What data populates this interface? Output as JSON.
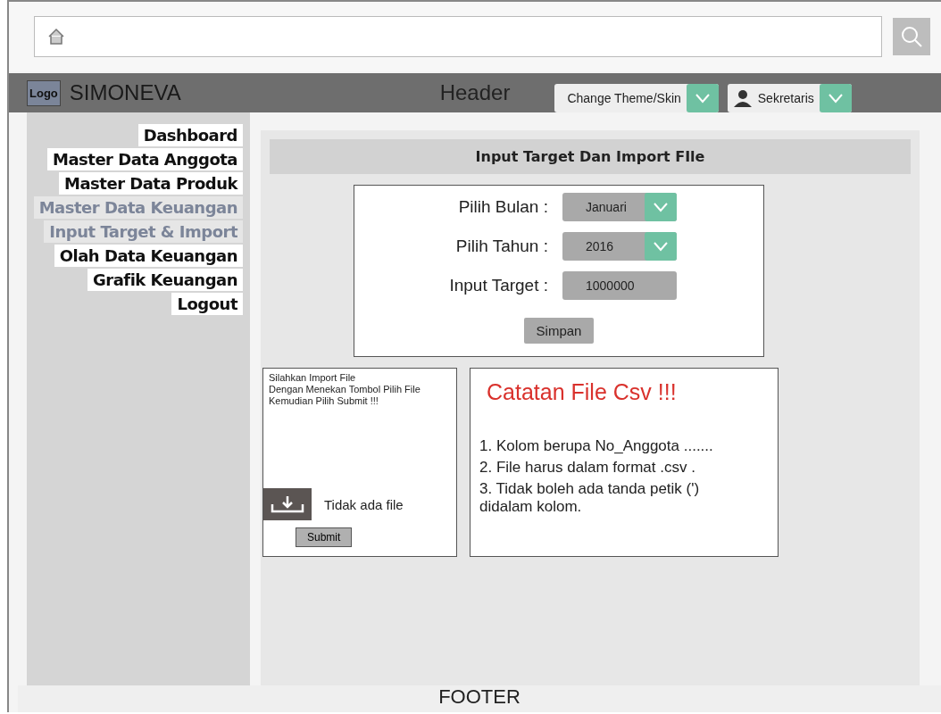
{
  "header": {
    "logo": "Logo",
    "app_name": "SIMONEVA",
    "title": "Header",
    "theme_dropdown": "Change Theme/Skin",
    "user": "Sekretaris"
  },
  "sidebar": {
    "items": [
      {
        "label": "Dashboard",
        "selected": false
      },
      {
        "label": "Master Data Anggota",
        "selected": false
      },
      {
        "label": "Master Data Produk",
        "selected": false
      },
      {
        "label": "Master Data Keuangan",
        "selected": true,
        "children": [
          {
            "label": "Input Target & Import",
            "selected": true
          }
        ]
      },
      {
        "label": "Olah Data Keuangan",
        "selected": false
      },
      {
        "label": "Grafik Keuangan",
        "selected": false
      },
      {
        "label": "Logout",
        "selected": false
      }
    ]
  },
  "page_title": "Input Target Dan Import FIle",
  "form": {
    "fields": [
      {
        "kind": "dropdown",
        "label": "Pilih Bulan :",
        "value": "Januari"
      },
      {
        "kind": "dropdown",
        "label": "Pilih Tahun :",
        "value": "2016"
      },
      {
        "kind": "input",
        "label": "Input Target :",
        "value": "1000000"
      }
    ],
    "save_button": "Simpan"
  },
  "import_panel": {
    "instructions": "Silahkan Import File\nDengan Menekan Tombol Pilih File\nKemudian Pilih Submit !!!",
    "file_status": "Tidak ada file",
    "submit_button": "Submit"
  },
  "notes_panel": {
    "title": "Catatan File Csv !!!",
    "items": [
      "1. Kolom berupa No_Anggota .......",
      "2. File harus dalam format .csv .",
      "3. Tidak boleh ada tanda petik (')\ndidalam kolom."
    ]
  },
  "footer": "FOOTER"
}
